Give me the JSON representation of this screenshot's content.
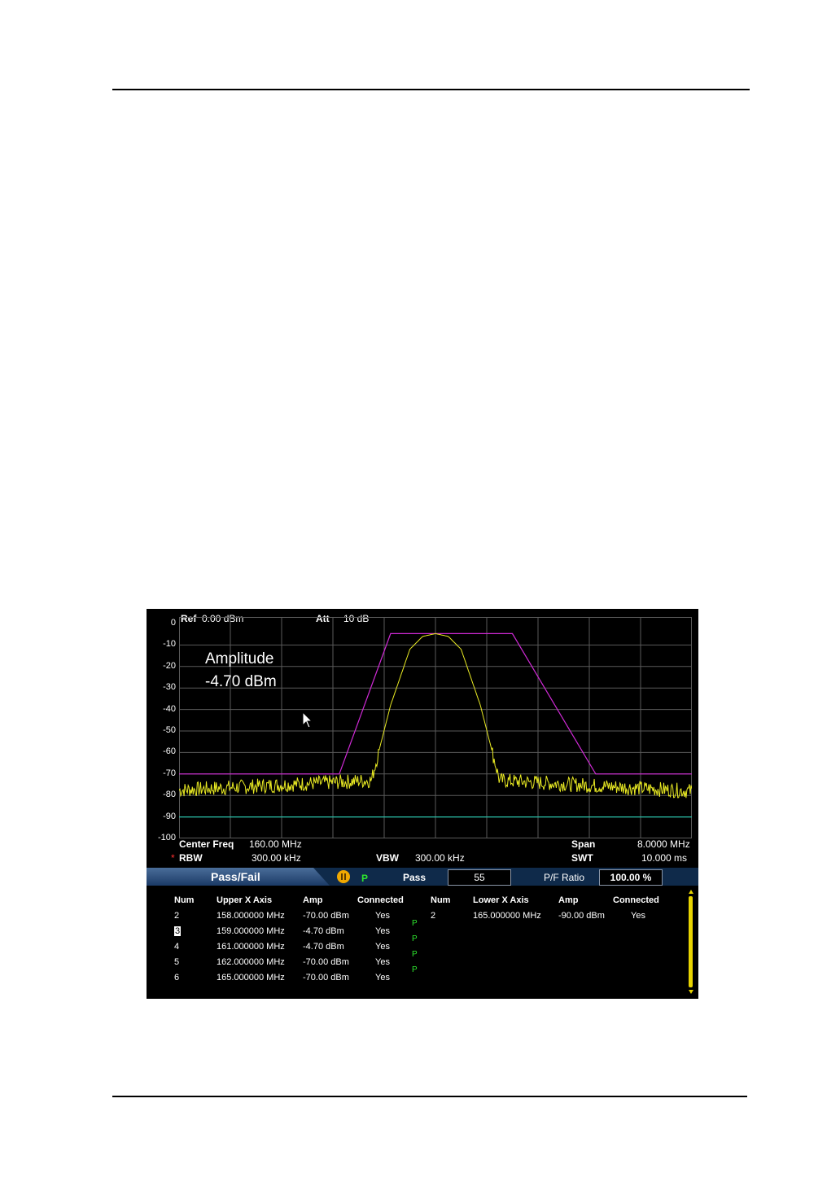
{
  "screen": {
    "ref": {
      "label": "Ref",
      "value": "0.00 dBm"
    },
    "att": {
      "label": "Att",
      "value": "10 dB"
    },
    "y_ticks": [
      "0",
      "-10",
      "-20",
      "-30",
      "-40",
      "-50",
      "-60",
      "-70",
      "-80",
      "-90",
      "-100"
    ],
    "annotation": {
      "line1": "Amplitude",
      "line2": "-4.70 dBm"
    },
    "center_freq": {
      "label": "Center Freq",
      "value": "160.00 MHz"
    },
    "span": {
      "label": "Span",
      "value": "8.0000 MHz"
    },
    "rbw": {
      "marker": "*",
      "label": "RBW",
      "value": "300.00 kHz"
    },
    "vbw": {
      "label": "VBW",
      "value": "300.00 kHz"
    },
    "swt": {
      "label": "SWT",
      "value": "10.000 ms"
    },
    "colors": {
      "upper_limit": "#d02ad6",
      "trace": "#e9ea23",
      "lower_limit": "#29c0a8",
      "grid": "#5a5a5a",
      "pass": "#2ee62e"
    }
  },
  "pass_fail": {
    "title": "Pass/Fail",
    "status_icon": "pause-icon",
    "status_letter": "P",
    "pass_label": "Pass",
    "pass_count": "55",
    "ratio_label": "P/F Ratio",
    "ratio_value": "100.00 %",
    "upper_table": {
      "headers": [
        "Num",
        "Upper X Axis",
        "Amp",
        "Connected"
      ],
      "rows": [
        [
          "2",
          "158.000000 MHz",
          "-70.00 dBm",
          "Yes"
        ],
        [
          "3",
          "159.000000 MHz",
          "-4.70 dBm",
          "Yes"
        ],
        [
          "4",
          "161.000000 MHz",
          "-4.70 dBm",
          "Yes"
        ],
        [
          "5",
          "162.000000 MHz",
          "-70.00 dBm",
          "Yes"
        ],
        [
          "6",
          "165.000000 MHz",
          "-70.00 dBm",
          "Yes"
        ]
      ],
      "segment_results": [
        "P",
        "P",
        "P",
        "P"
      ]
    },
    "lower_table": {
      "headers": [
        "Num",
        "Lower X Axis",
        "Amp",
        "Connected"
      ],
      "rows": [
        [
          "2",
          "165.000000 MHz",
          "-90.00 dBm",
          "Yes"
        ]
      ]
    }
  },
  "chart_data": {
    "type": "line",
    "title": "",
    "xlabel": "",
    "ylabel": "",
    "xlim": [
      156,
      164
    ],
    "ylim": [
      -100,
      0
    ],
    "x_unit": "MHz",
    "y_unit": "dBm",
    "grid": true,
    "series": [
      {
        "x": [
          156,
          158.5,
          159.3,
          161.2,
          162.5,
          164
        ],
        "y": [
          -70,
          -70,
          -4.7,
          -4.7,
          -70,
          -70
        ]
      },
      {
        "x": [
          156,
          159.0,
          159.3,
          159.6,
          159.8,
          160.0,
          160.2,
          160.4,
          160.7,
          161.0,
          164
        ],
        "y": [
          -77.5,
          -73,
          -38,
          -12,
          -6,
          -4.7,
          -6,
          -12,
          -38,
          -73,
          -78
        ]
      },
      {
        "x": [
          156,
          164
        ],
        "y": [
          -90,
          -90
        ]
      }
    ]
  }
}
